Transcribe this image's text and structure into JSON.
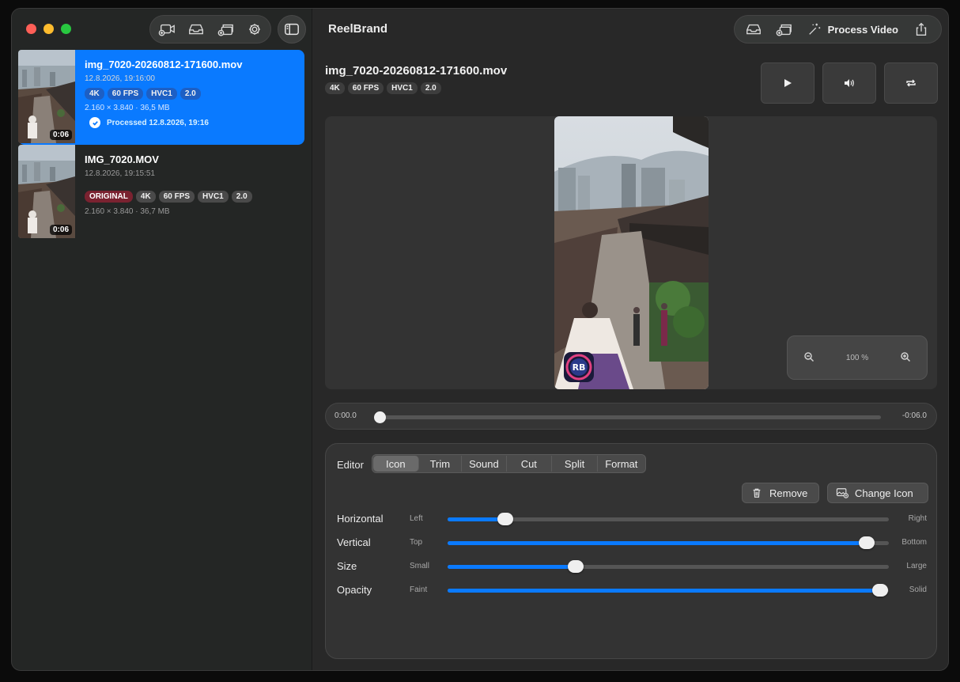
{
  "app": {
    "title": "ReelBrand"
  },
  "files": [
    {
      "name": "img_7020-20260812-171600.mov",
      "date": "12.8.2026, 19:16:00",
      "badges": [
        "4K",
        "60 FPS",
        "HVC1",
        "2.0"
      ],
      "resolution": "2.160 × 3.840 · 36,5 MB",
      "duration": "0:06",
      "processed": "Processed 12.8.2026, 19:16",
      "selected": true
    },
    {
      "name": "IMG_7020.MOV",
      "date": "12.8.2026, 19:15:51",
      "original_badge": "ORIGINAL",
      "badges": [
        "4K",
        "60 FPS",
        "HVC1",
        "2.0"
      ],
      "resolution": "2.160 × 3.840 · 36,7 MB",
      "duration": "0:06",
      "selected": false
    }
  ],
  "toolbar": {
    "process_label": "Process Video",
    "left_icons": [
      "add-video-icon",
      "inbox-icon",
      "stack-icon",
      "gear-icon"
    ],
    "right_icons": [
      "inbox-icon",
      "stack-icon",
      "sparkles-icon",
      "share-icon"
    ]
  },
  "video": {
    "title": "img_7020-20260812-171600.mov",
    "badges": [
      "4K",
      "60 FPS",
      "HVC1",
      "2.0"
    ],
    "zoom": "100 %",
    "overlay_logo_text": "RB"
  },
  "timeline": {
    "start": "0:00.0",
    "end": "-0:06.0",
    "position": 0.0
  },
  "editor": {
    "label": "Editor",
    "tabs": [
      "Icon",
      "Trim",
      "Sound",
      "Cut",
      "Split",
      "Format"
    ],
    "active_tab": "Icon",
    "remove_label": "Remove",
    "change_icon_label": "Change Icon",
    "sliders": [
      {
        "label": "Horizontal",
        "min": "Left",
        "max": "Right",
        "value": 0.13
      },
      {
        "label": "Vertical",
        "min": "Top",
        "max": "Bottom",
        "value": 0.95
      },
      {
        "label": "Size",
        "min": "Small",
        "max": "Large",
        "value": 0.29
      },
      {
        "label": "Opacity",
        "min": "Faint",
        "max": "Solid",
        "value": 0.98
      }
    ]
  },
  "colors": {
    "accent": "#0a7aff",
    "original_badge": "#7a2230"
  }
}
